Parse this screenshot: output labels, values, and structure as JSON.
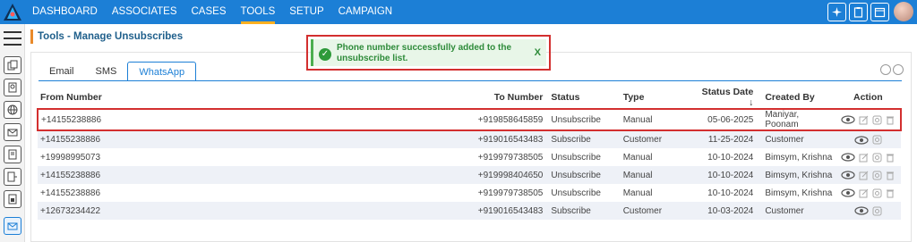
{
  "nav": {
    "items": [
      "DASHBOARD",
      "ASSOCIATES",
      "CASES",
      "TOOLS",
      "SETUP",
      "CAMPAIGN"
    ],
    "active": "TOOLS"
  },
  "page": {
    "title": "Tools - Manage Unsubscribes"
  },
  "toast": {
    "message": "Phone number successfully added to the unsubscribe list.",
    "close": "X"
  },
  "tabs": [
    "Email",
    "SMS",
    "WhatsApp"
  ],
  "table": {
    "headers": [
      "From Number",
      "To Number",
      "Status",
      "Type",
      "Status Date",
      "Created By",
      "Action"
    ],
    "sort_indicator": "↓",
    "rows": [
      {
        "from": "+14155238886",
        "to": "+919858645859",
        "status": "Unsubscribe",
        "type": "Manual",
        "date": "05-06-2025",
        "by": "Maniyar, Poonam",
        "actions": [
          "view",
          "edit",
          "copy",
          "delete"
        ]
      },
      {
        "from": "+14155238886",
        "to": "+919016543483",
        "status": "Subscribe",
        "type": "Customer",
        "date": "11-25-2024",
        "by": "Customer",
        "actions": [
          "view",
          "copy"
        ]
      },
      {
        "from": "+19998995073",
        "to": "+919979738505",
        "status": "Unsubscribe",
        "type": "Manual",
        "date": "10-10-2024",
        "by": "Bimsym, Krishna",
        "actions": [
          "view",
          "edit",
          "copy",
          "delete"
        ]
      },
      {
        "from": "+14155238886",
        "to": "+919998404650",
        "status": "Unsubscribe",
        "type": "Manual",
        "date": "10-10-2024",
        "by": "Bimsym, Krishna",
        "actions": [
          "view",
          "edit",
          "copy",
          "delete"
        ]
      },
      {
        "from": "+14155238886",
        "to": "+919979738505",
        "status": "Unsubscribe",
        "type": "Manual",
        "date": "10-10-2024",
        "by": "Bimsym, Krishna",
        "actions": [
          "view",
          "edit",
          "copy",
          "delete"
        ]
      },
      {
        "from": "+12673234422",
        "to": "+919016543483",
        "status": "Subscribe",
        "type": "Customer",
        "date": "10-03-2024",
        "by": "Customer",
        "actions": [
          "view",
          "copy"
        ]
      }
    ]
  },
  "colors": {
    "brand": "#1c7fd6",
    "accent": "#e98a2a",
    "success": "#2e8b3a",
    "highlight": "#d32f2f"
  }
}
